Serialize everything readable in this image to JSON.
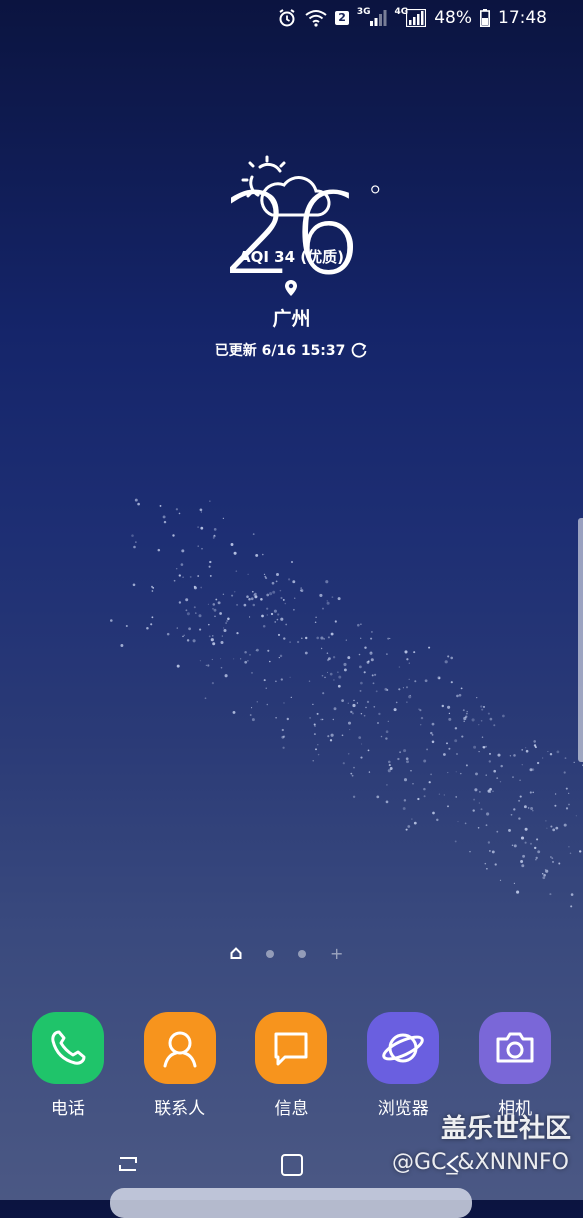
{
  "status_bar": {
    "alarm_icon": "alarm-clock-icon",
    "wifi_icon": "wifi-icon",
    "sim_badge": "2",
    "net1_label": "3G",
    "net2_label": "4G",
    "battery_percent": "48%",
    "time": "17:48"
  },
  "weather": {
    "temperature": "26",
    "unit": "°",
    "condition_icon": "partly-cloudy-icon",
    "aqi": "AQI 34 (优质)",
    "location_icon": "location-pin-icon",
    "city": "广州",
    "updated": "已更新 6/16 15:37",
    "refresh_icon": "refresh-icon"
  },
  "home_pages": {
    "count": 3,
    "current": 0,
    "add_icon": "+"
  },
  "dock": {
    "apps": [
      {
        "label": "电话",
        "icon": "phone-icon",
        "color": "#1fc46a"
      },
      {
        "label": "联系人",
        "icon": "contacts-icon",
        "color": "#f7941d"
      },
      {
        "label": "信息",
        "icon": "message-icon",
        "color": "#f7941d"
      },
      {
        "label": "浏览器",
        "icon": "browser-icon",
        "color": "#6a5fe0"
      },
      {
        "label": "相机",
        "icon": "camera-icon",
        "color": "#7a67d8"
      }
    ]
  },
  "overlay": {
    "watermark": "盖乐世社区",
    "watermark_sub": "@GC_&XNNNFO"
  }
}
